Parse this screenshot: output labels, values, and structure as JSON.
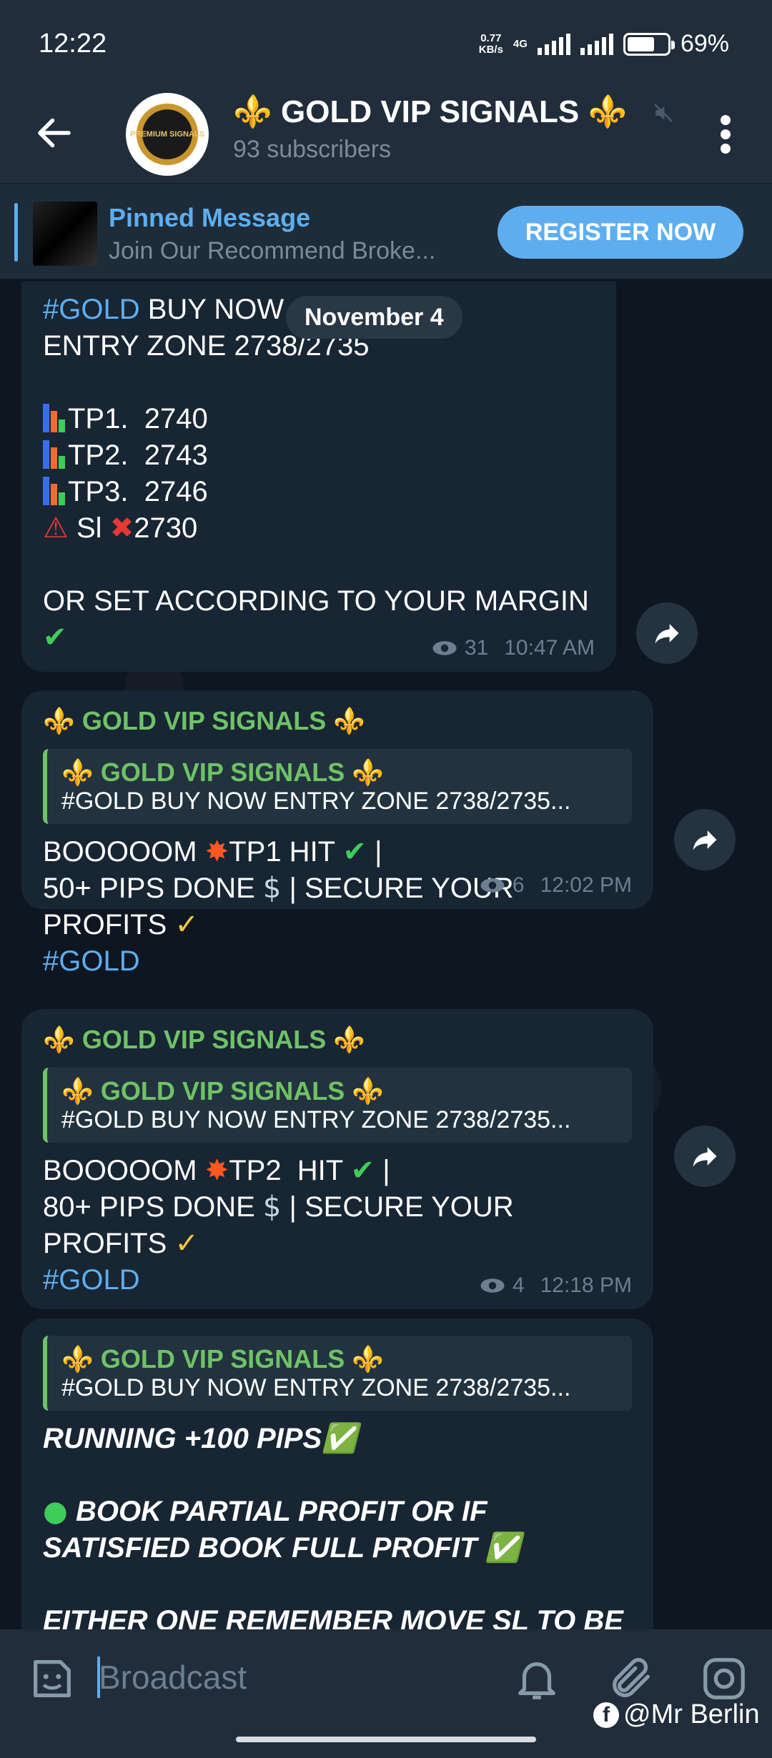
{
  "status": {
    "time": "12:22",
    "speed_top": "0.77",
    "speed_bottom": "KB/s",
    "network": "4G",
    "battery_pct": "69%",
    "battery_level": 0.69
  },
  "header": {
    "title": "⚜️ GOLD VIP SIGNALS ⚜️",
    "subtitle": "93 subscribers",
    "avatar_text": "PREMIUM SIGNALS"
  },
  "pinned": {
    "title": "Pinned Message",
    "text": "Join Our Recommend Broke...",
    "button": "REGISTER NOW"
  },
  "chat": {
    "date_chip": "November 4",
    "msg1": {
      "line1_tag": "#GOLD",
      "line1_rest": " BUY NOW",
      "line2": "ENTRY ZONE 2738/2735",
      "tp1": "TP1.  2740",
      "tp2": "TP2.  2743",
      "tp3": "TP3.  2746",
      "sl_label": "Sl",
      "sl_value": "2730",
      "line_margin": "OR SET ACCORDING TO YOUR MARGIN",
      "views": "31",
      "time": "10:47 AM"
    },
    "msg2": {
      "sender": "⚜️ GOLD VIP SIGNALS ⚜️",
      "quote_name": "⚜️ GOLD VIP SIGNALS ⚜️",
      "quote_text": "#GOLD BUY NOW ENTRY ZONE 2738/2735...",
      "line1a": "BOOOOOM ",
      "line1b": "TP1 HIT ",
      "line1c": " |",
      "line2a": "50+ PIPS DONE ",
      "line2b": " | SECURE YOUR",
      "line3": "PROFITS ",
      "tag": "#GOLD",
      "views": "6",
      "time": "12:02 PM"
    },
    "msg3": {
      "sender": "⚜️ GOLD VIP SIGNALS ⚜️",
      "quote_name": "⚜️ GOLD VIP SIGNALS ⚜️",
      "quote_text": "#GOLD BUY NOW ENTRY ZONE 2738/2735...",
      "line1a": "BOOOOOM ",
      "line1b": "TP2  HIT ",
      "line1c": " |",
      "line2a": "80+ PIPS DONE ",
      "line2b": " | SECURE YOUR",
      "line3": "PROFITS ",
      "tag": "#GOLD",
      "views": "4",
      "time": "12:18 PM"
    },
    "msg4": {
      "quote_name": "⚜️ GOLD VIP SIGNALS ⚜️",
      "quote_text": "#GOLD BUY NOW ENTRY ZONE 2738/2735...",
      "line1": "RUNNING +100 PIPS",
      "line2": "BOOK PARTIAL PROFIT OR IF",
      "line3": "SATISFIED BOOK FULL PROFIT",
      "line4": "EITHER ONE REMEMBER MOVE SL TO BE"
    }
  },
  "input": {
    "placeholder": "Broadcast",
    "watermark": "@Mr Berlin"
  },
  "colors": {
    "accent": "#5eaeef",
    "sender_green": "#6fc267",
    "bubble": "#182533",
    "background": "#0e1621"
  }
}
